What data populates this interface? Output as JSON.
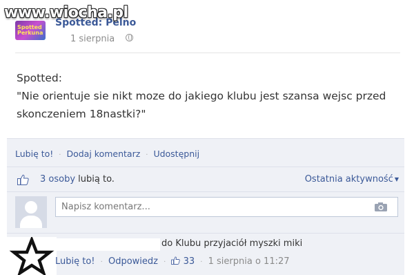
{
  "watermark": "www.wiocha.pl",
  "page": {
    "logo_text": "Spotted Perkuna",
    "name": "Spotted: Pelno",
    "date": "1 sierpnia"
  },
  "post": {
    "text": "Spotted:\n\"Nie orientuje sie nikt moze do jakiego klubu jest szansa wejsc przed skonczeniem 18nastki?\""
  },
  "actions": {
    "like": "Lubię to!",
    "comment": "Dodaj komentarz",
    "share": "Udostępnij",
    "separator": "·"
  },
  "likes": {
    "count": "3 osoby",
    "suffix": "lubią to.",
    "activity": "Ostatnia aktywność"
  },
  "comment_input": {
    "placeholder": "Napisz komentarz..."
  },
  "reply": {
    "text": "do Klubu przyjaciół myszki miki",
    "like": "Lubię to!",
    "answer": "Odpowiedz",
    "like_count": "33",
    "timestamp": "1 sierpnia o 11:27"
  },
  "colors": {
    "link": "#3b5998",
    "box_bg": "#eff1f6"
  }
}
